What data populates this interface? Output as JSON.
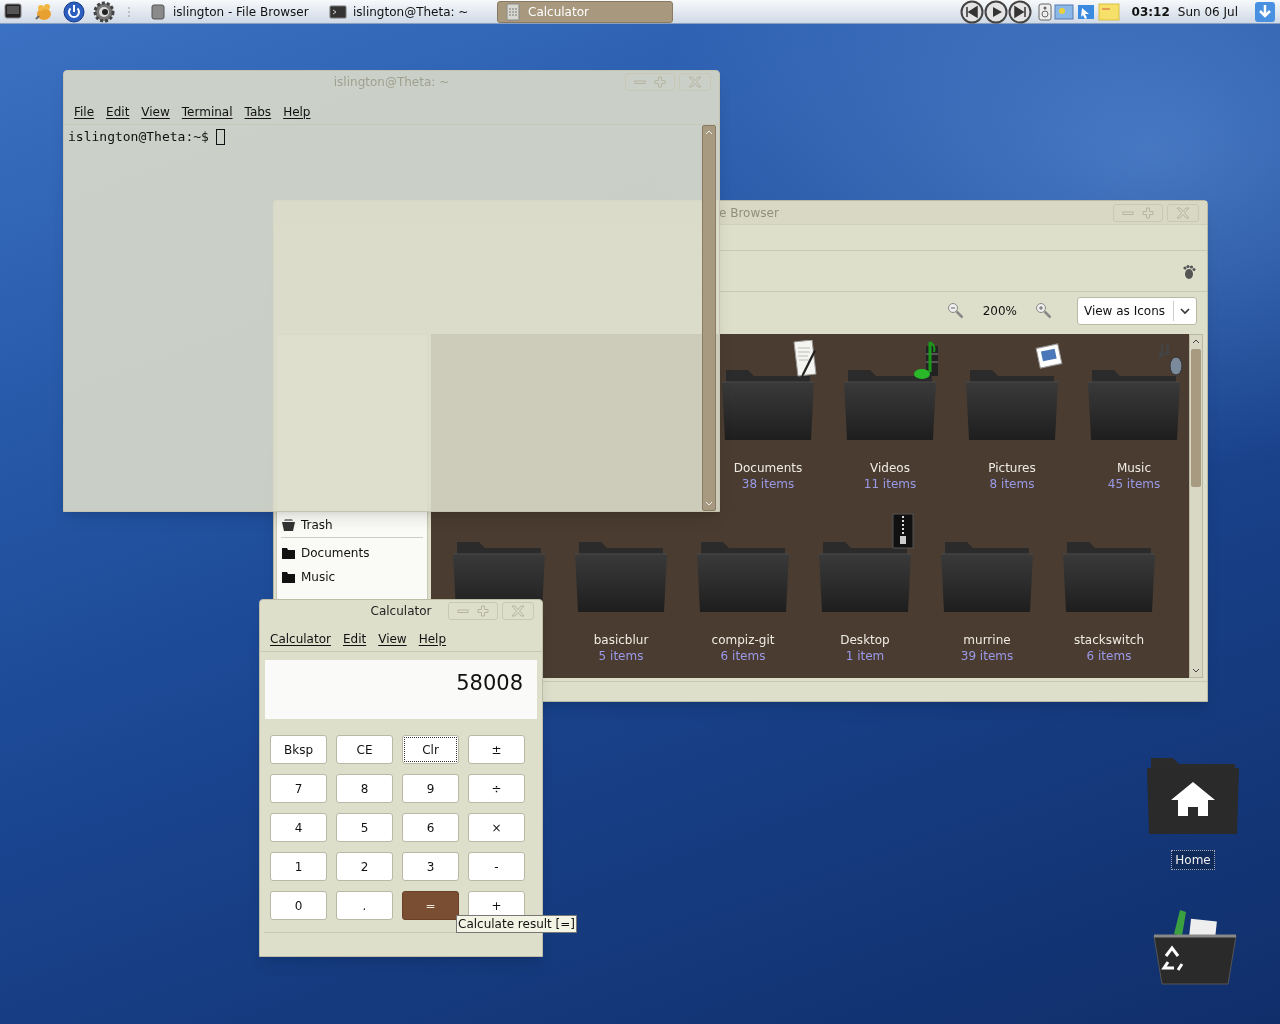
{
  "panel": {
    "launchers": [
      {
        "kind": "terminal"
      },
      {
        "kind": "gimp"
      },
      {
        "kind": "power"
      },
      {
        "kind": "gear"
      }
    ],
    "tasks": [
      {
        "label": "islington - File Browser",
        "kind": "drive",
        "selected": false
      },
      {
        "label": "islington@Theta: ~",
        "kind": "terminal",
        "selected": false
      },
      {
        "label": "Calculator",
        "kind": "calculator",
        "selected": true
      }
    ],
    "clock": {
      "time": "03:12",
      "date": "Sun 06 Jul"
    }
  },
  "terminal": {
    "title": "islington@Theta: ~",
    "menu": [
      "File",
      "Edit",
      "View",
      "Terminal",
      "Tabs",
      "Help"
    ],
    "prompt": "islington@Theta:~$"
  },
  "file_browser": {
    "title": "e Browser",
    "zoom": "200%",
    "view_mode": "View as Icons",
    "sidebar": [
      {
        "label": "Trash",
        "kind": "trash"
      },
      {
        "label": "Documents",
        "kind": "folder"
      },
      {
        "label": "Music",
        "kind": "folder"
      }
    ],
    "folder_rows": [
      [
        {
          "name": "Documents",
          "count": "38 items",
          "kind": "document"
        },
        {
          "name": "Videos",
          "count": "11 items",
          "kind": "music"
        },
        {
          "name": "Pictures",
          "count": "8 items",
          "kind": "picture"
        },
        {
          "name": "Music",
          "count": "45 items",
          "kind": "note"
        }
      ],
      [
        {
          "kind": "plain"
        },
        {
          "name": "basicblur",
          "count": "5 items",
          "kind": "plain"
        },
        {
          "name": "compiz-git",
          "count": "6 items",
          "kind": "plain"
        },
        {
          "name": "Desktop",
          "count": "1 item",
          "kind": "zip"
        },
        {
          "name": "murrine",
          "count": "39 items",
          "kind": "plain"
        },
        {
          "name": "stackswitch",
          "count": "6 items",
          "kind": "plain"
        }
      ]
    ]
  },
  "calculator": {
    "title": "Calculator",
    "menu": [
      "Calculator",
      "Edit",
      "View",
      "Help"
    ],
    "display": "58008",
    "buttons": [
      {
        "label": "Bksp",
        "kind": "plain",
        "focused": false
      },
      {
        "label": "CE",
        "kind": "plain",
        "focused": false
      },
      {
        "label": "Clr",
        "kind": "plain",
        "focused": true
      },
      {
        "label": "±",
        "kind": "plain",
        "focused": false
      },
      {
        "label": "7",
        "kind": "plain",
        "focused": false
      },
      {
        "label": "8",
        "kind": "plain",
        "focused": false
      },
      {
        "label": "9",
        "kind": "plain",
        "focused": false
      },
      {
        "label": "÷",
        "kind": "plain",
        "focused": false
      },
      {
        "label": "4",
        "kind": "plain",
        "focused": false
      },
      {
        "label": "5",
        "kind": "plain",
        "focused": false
      },
      {
        "label": "6",
        "kind": "plain",
        "focused": false
      },
      {
        "label": "×",
        "kind": "plain",
        "focused": false
      },
      {
        "label": "1",
        "kind": "plain",
        "focused": false
      },
      {
        "label": "2",
        "kind": "plain",
        "focused": false
      },
      {
        "label": "3",
        "kind": "plain",
        "focused": false
      },
      {
        "label": "-",
        "kind": "plain",
        "focused": false
      },
      {
        "label": "0",
        "kind": "plain",
        "focused": false
      },
      {
        "label": ".",
        "kind": "plain",
        "focused": false
      },
      {
        "label": "=",
        "kind": "equals",
        "focused": false
      },
      {
        "label": "+",
        "kind": "plain",
        "focused": false
      }
    ],
    "tooltip": "Calculate result [=]"
  },
  "desktop_icons": [
    {
      "label": "Home",
      "kind": "home"
    },
    {
      "kind": "recycle"
    }
  ]
}
